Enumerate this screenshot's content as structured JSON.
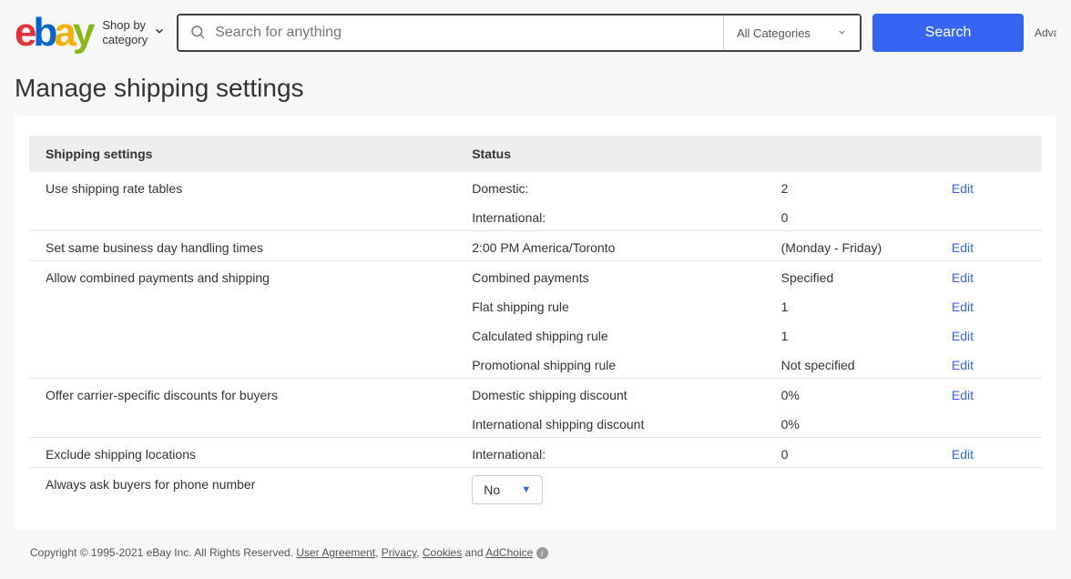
{
  "header": {
    "shop_by_line1": "Shop by",
    "shop_by_line2": "category",
    "search_placeholder": "Search for anything",
    "category_selected": "All Categories",
    "search_button": "Search",
    "advanced": "Advanced"
  },
  "page_title": "Manage shipping settings",
  "table": {
    "headers": {
      "setting": "Shipping settings",
      "status": "Status"
    },
    "rows": [
      {
        "setting": "Use shipping rate tables",
        "lines": [
          {
            "status": "Domestic:",
            "value": "2",
            "action": "Edit"
          },
          {
            "status": "International:",
            "value": "0",
            "action": ""
          }
        ]
      },
      {
        "setting": "Set same business day handling times",
        "lines": [
          {
            "status": "2:00 PM America/Toronto",
            "value": "(Monday - Friday)",
            "action": "Edit"
          }
        ]
      },
      {
        "setting": "Allow combined payments and shipping",
        "lines": [
          {
            "status": "Combined payments",
            "value": "Specified",
            "action": "Edit"
          },
          {
            "status": "Flat shipping rule",
            "value": "1",
            "action": "Edit"
          },
          {
            "status": "Calculated shipping rule",
            "value": "1",
            "action": "Edit"
          },
          {
            "status": "Promotional shipping rule",
            "value": "Not specified",
            "action": "Edit"
          }
        ]
      },
      {
        "setting": "Offer carrier-specific discounts for buyers",
        "lines": [
          {
            "status": "Domestic shipping discount",
            "value": "0%",
            "action": "Edit"
          },
          {
            "status": "International shipping discount",
            "value": "0%",
            "action": ""
          }
        ]
      },
      {
        "setting": "Exclude shipping locations",
        "lines": [
          {
            "status": "International:",
            "value": "0",
            "action": "Edit"
          }
        ]
      },
      {
        "setting": "Always ask buyers for phone number",
        "lines": [
          {
            "select": "No"
          }
        ]
      }
    ]
  },
  "footer": {
    "copyright": "Copyright © 1995-2021 eBay Inc. All Rights Reserved. ",
    "links": {
      "user_agreement": "User Agreement",
      "privacy": "Privacy",
      "cookies": "Cookies",
      "adchoice": "AdChoice"
    },
    "and": " and "
  }
}
